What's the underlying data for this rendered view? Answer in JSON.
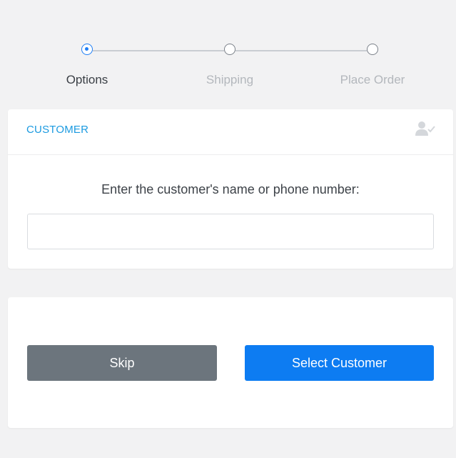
{
  "stepper": {
    "steps": [
      {
        "label": "Options",
        "state": "active"
      },
      {
        "label": "Shipping",
        "state": "inactive"
      },
      {
        "label": "Place Order",
        "state": "inactive"
      }
    ]
  },
  "customer_card": {
    "title": "CUSTOMER",
    "header_icon": "user-check-icon",
    "prompt": "Enter the customer's name or phone number:",
    "input": {
      "value": "",
      "placeholder": ""
    }
  },
  "actions": {
    "skip_label": "Skip",
    "select_label": "Select Customer"
  },
  "colors": {
    "accent": "#0d7cf2",
    "title": "#1b9ae0",
    "skip": "#6c757d",
    "background": "#f2f2f3"
  }
}
